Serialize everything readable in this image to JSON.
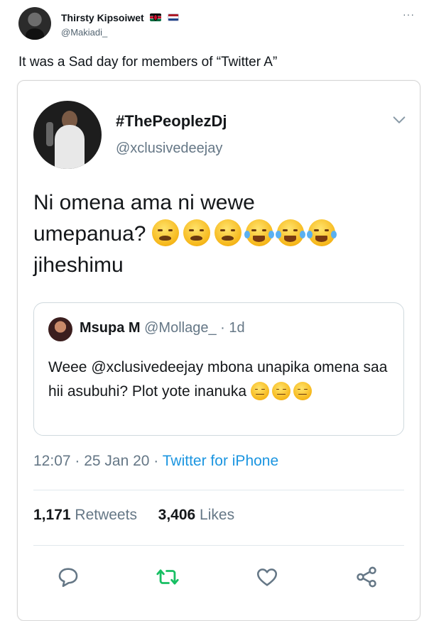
{
  "tweet": {
    "display_name": "Thirsty Kipsoiwet",
    "handle": "@Makiadi_",
    "text": "It was a Sad day for members of “Twitter A”",
    "more_icon": "more-horizontal-icon"
  },
  "embedded": {
    "display_name": "#ThePeoplezDj",
    "handle": "@xclusivedeejay",
    "text_line1": "Ni omena ama ni wewe",
    "text_line2": "umepanua?",
    "text_line3": "jiheshimu",
    "quote": {
      "display_name": "Msupa M",
      "handle_and_time": "@Mollage_ · 1d",
      "text": "Weee @xclusivedeejay mbona unapika omena saa hii asubuhi? Plot yote inanuka"
    },
    "time": "12:07 · 25 Jan 20 · ",
    "source": "Twitter for iPhone",
    "retweets_count": "1,171",
    "retweets_label": "Retweets",
    "likes_count": "3,406",
    "likes_label": "Likes"
  },
  "colors": {
    "link": "#1b95e0",
    "secondary": "#657786",
    "retweet_active": "#17bf63"
  }
}
